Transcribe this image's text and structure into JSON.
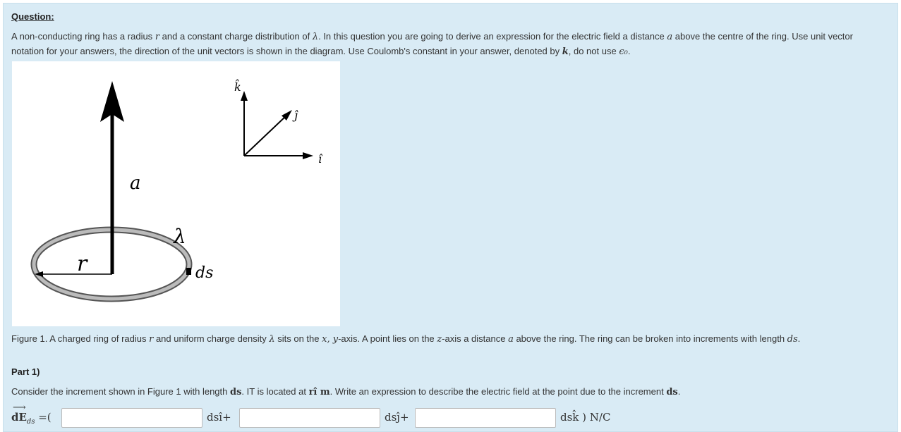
{
  "question": {
    "heading": "Question:",
    "text_1": "A non-conducting ring has a radius ",
    "sym_r": "r",
    "text_2": " and a constant charge distribution of ",
    "sym_lambda": "λ",
    "text_3": ". In this question you are going to derive an expression for the electric field a distance ",
    "sym_a": "a",
    "text_4": " above the centre of the ring. Use unit vector notation for your answers, the direction of the unit vectors is shown in the diagram. Use Coulomb's constant in your answer, denoted by ",
    "sym_k": "k",
    "text_5": ", do not use ",
    "sym_eps": "ϵ₀",
    "text_6": "."
  },
  "figure": {
    "label_a": "a",
    "label_lambda": "λ",
    "label_r": "r",
    "label_ds": "ds",
    "label_k": "k̂",
    "label_j": "ĵ",
    "label_i": "î"
  },
  "caption": {
    "t1": "Figure 1. A charged ring of radius ",
    "s_r": "r",
    "t2": " and uniform charge density ",
    "s_lambda": "λ",
    "t3": " sits on the ",
    "s_xy": "x, y",
    "t4": "-axis. A point lies on the ",
    "s_z": "z",
    "t5": "-axis a distance ",
    "s_a": "a",
    "t6": " above the ring. The ring can be broken into increments with length ",
    "s_ds": "ds",
    "t7": "."
  },
  "part": {
    "label": "Part 1)"
  },
  "consider": {
    "t1": "Consider the increment shown in Figure 1 with length ",
    "s_ds": "ds",
    "t2": ". IT is located at ",
    "s_ri": "rî m",
    "t3": ". Write an expression to describe the electric field at the point due to the increment ",
    "s_ds2": "ds",
    "t4": "."
  },
  "answer": {
    "lhs": "dE",
    "lhs_sub": "ds",
    "eq_open": " =(",
    "term_i": "dsî+",
    "term_j": "dsĵ+",
    "term_k": "dsk̂ ) N/C",
    "input1": "",
    "input2": "",
    "input3": ""
  }
}
